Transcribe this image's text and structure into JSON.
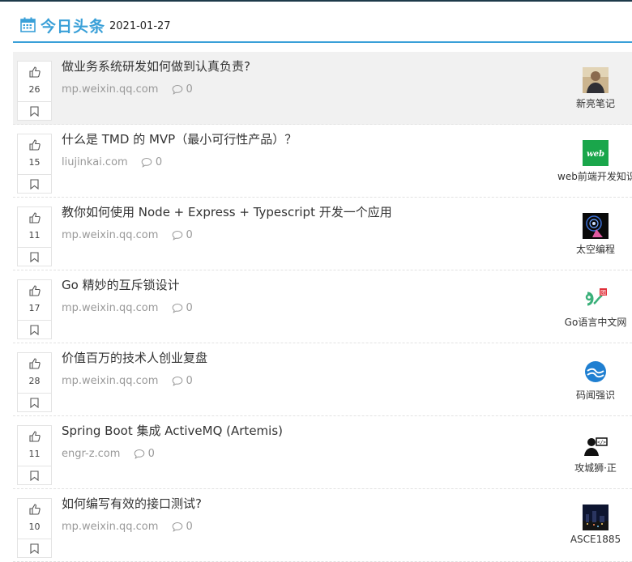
{
  "section": {
    "title": "今日头条",
    "date": "2021-01-27",
    "accent_color": "#3aa0d8",
    "icon": "calendar-icon"
  },
  "articles": [
    {
      "likes": "26",
      "title": "做业务系统研发如何做到认真负责?",
      "source": "mp.weixin.qq.com",
      "comments": "0",
      "author": "新亮笔记",
      "avatar": "portrait-avatar"
    },
    {
      "likes": "15",
      "title": "什么是 TMD 的 MVP（最小可行性产品）？",
      "source": "liujinkai.com",
      "comments": "0",
      "author": "web前端开发知识",
      "avatar": "web-logo-avatar"
    },
    {
      "likes": "11",
      "title": "教你如何使用 Node + Express + Typescript 开发一个应用",
      "source": "mp.weixin.qq.com",
      "comments": "0",
      "author": "太空编程",
      "avatar": "space-avatar"
    },
    {
      "likes": "17",
      "title": "Go 精妙的互斥锁设计",
      "source": "mp.weixin.qq.com",
      "comments": "0",
      "author": "Go语言中文网",
      "avatar": "go-gopher-avatar"
    },
    {
      "likes": "28",
      "title": "价值百万的技术人创业复盘",
      "source": "mp.weixin.qq.com",
      "comments": "0",
      "author": "码闻强识",
      "avatar": "blue-circle-avatar"
    },
    {
      "likes": "11",
      "title": "Spring Boot 集成 ActiveMQ (Artemis)",
      "source": "engr-z.com",
      "comments": "0",
      "author": "攻城狮·正",
      "avatar": "coder-avatar"
    },
    {
      "likes": "10",
      "title": "如何编写有效的接口测试?",
      "source": "mp.weixin.qq.com",
      "comments": "0",
      "author": "ASCE1885",
      "avatar": "night-city-avatar"
    }
  ]
}
